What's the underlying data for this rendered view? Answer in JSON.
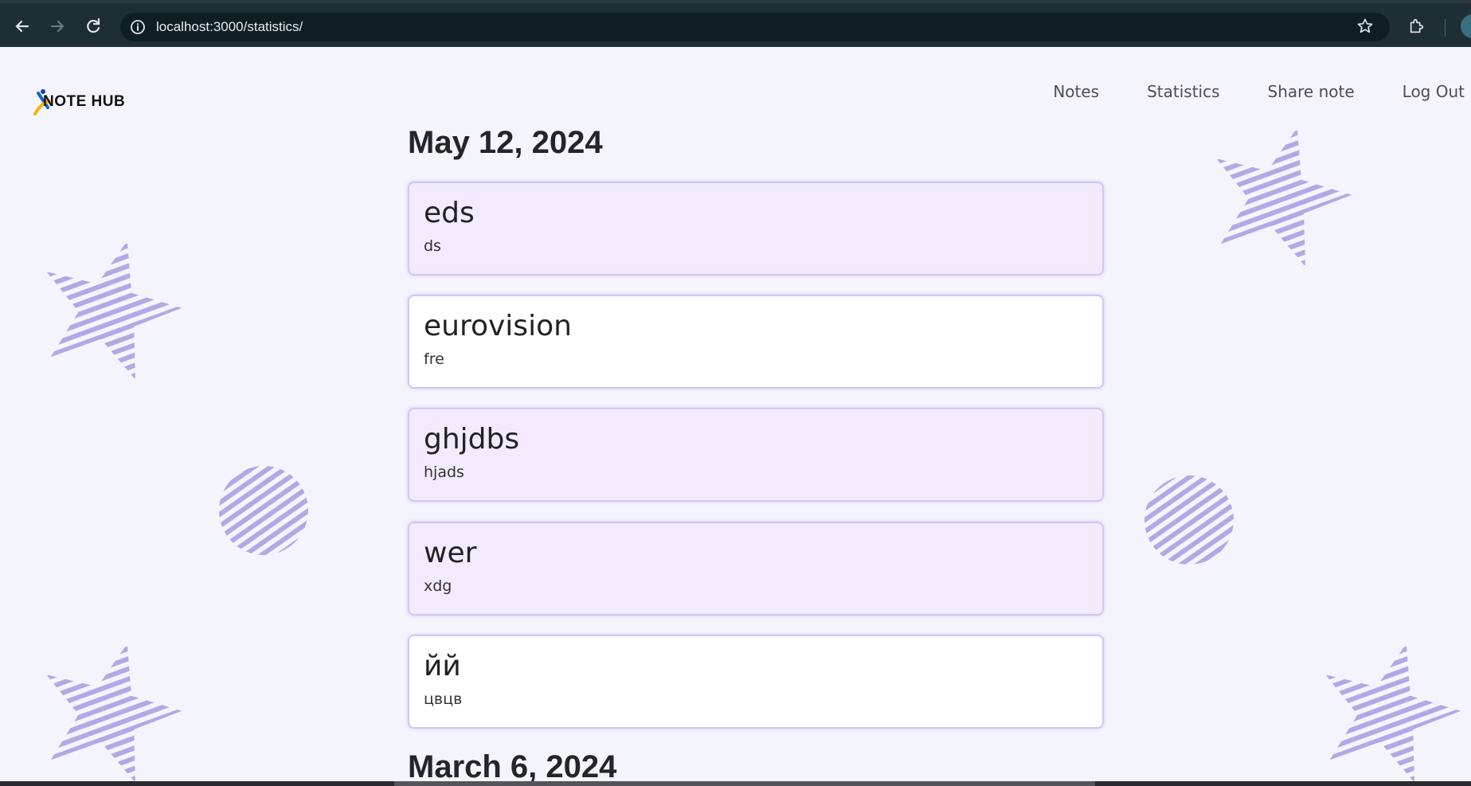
{
  "browser": {
    "url": "localhost:3000/statistics/"
  },
  "header": {
    "logo_text": "NOTE HUB",
    "nav": [
      "Notes",
      "Statistics",
      "Share note",
      "Log Out"
    ]
  },
  "sections": [
    {
      "date": "May 12, 2024",
      "notes": [
        {
          "title": "eds",
          "body": "ds"
        },
        {
          "title": "eurovision",
          "body": "fre"
        },
        {
          "title": "ghjdbs",
          "body": "hjads"
        },
        {
          "title": "wer",
          "body": "xdg"
        },
        {
          "title": "йй",
          "body": "цвцв"
        }
      ]
    },
    {
      "date": "March 6, 2024",
      "notes": []
    }
  ],
  "colors": {
    "page_bg": "#f4f4fd",
    "card_tint": "#f3eafd",
    "card_border": "#d0c8f4",
    "decoration": "#b7aee6"
  }
}
